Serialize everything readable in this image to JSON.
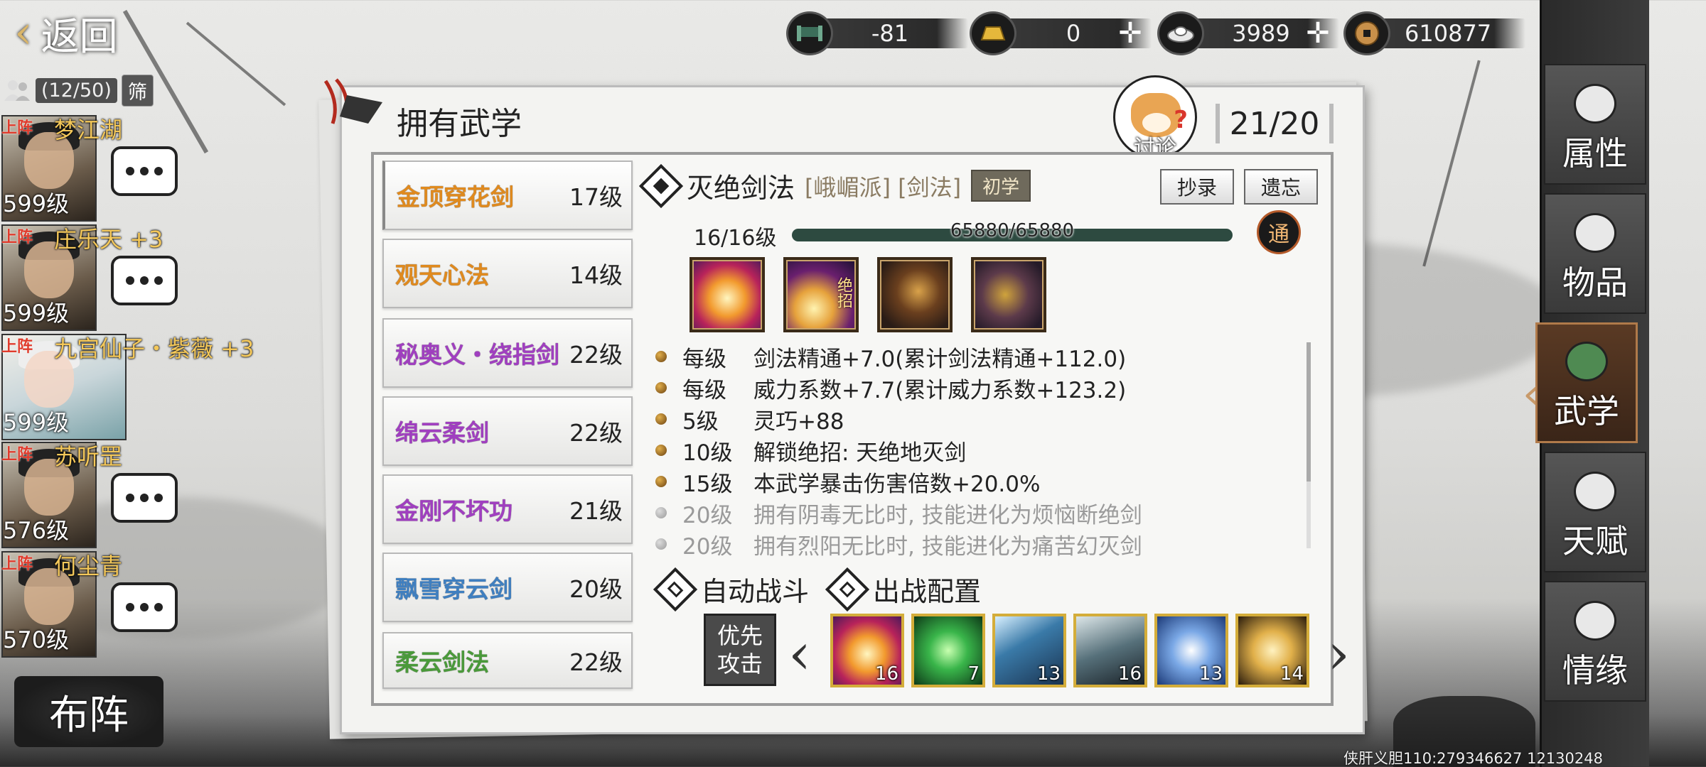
{
  "topbar": {
    "back_label": "返回",
    "resources": [
      {
        "icon": "bed-icon",
        "value": "-81",
        "has_plus": false
      },
      {
        "icon": "gold-ingot-icon",
        "value": "0",
        "has_plus": true
      },
      {
        "icon": "silver-ingot-icon",
        "value": "3989",
        "has_plus": true
      },
      {
        "icon": "copper-coin-icon",
        "value": "610877",
        "has_plus": false
      }
    ]
  },
  "roster": {
    "count": "(12/50)",
    "filter_label": "筛",
    "heroes": [
      {
        "deploy": "上阵",
        "name": "梦江湖",
        "level": "599级"
      },
      {
        "deploy": "上阵",
        "name": "庄乐天 +3",
        "level": "599级"
      },
      {
        "deploy": "上阵",
        "name": "九宫仙子・紫薇 +3",
        "level": "599级"
      },
      {
        "deploy": "上阵",
        "name": "苏听罡",
        "level": "576级"
      },
      {
        "deploy": "上阵",
        "name": "何尘青",
        "level": "570级"
      }
    ],
    "formation_label": "布阵"
  },
  "panel": {
    "title": "拥有武学",
    "discuss_label": "讨论",
    "count": "21/20",
    "skills": [
      {
        "name": "金顶穿花剑",
        "level": "17级",
        "color": "#e08a1e"
      },
      {
        "name": "观天心法",
        "level": "14级",
        "color": "#e08a1e"
      },
      {
        "name": "秘奥义・绕指剑",
        "level": "22级",
        "color": "#a03fc0"
      },
      {
        "name": "绵云柔剑",
        "level": "22级",
        "color": "#a03fc0"
      },
      {
        "name": "金刚不坏功",
        "level": "21级",
        "color": "#a03fc0"
      },
      {
        "name": "飘雪穿云剑",
        "level": "20级",
        "color": "#3f7fc0"
      },
      {
        "name": "柔云剑法",
        "level": "22级",
        "color": "#4a9a3a"
      }
    ]
  },
  "detail": {
    "name": "灭绝剑法",
    "tags": "[峨嵋派] [剑法]",
    "badge": "初学",
    "copy_label": "抄录",
    "forget_label": "遗忘",
    "level": "16/16级",
    "exp_text": "65880/65880",
    "exp_fraction": 1.0,
    "tong_label": "通",
    "ultimate_label": "绝招",
    "effects": [
      {
        "lv": "每级",
        "text": "剑法精通+7.0(累计剑法精通+112.0)",
        "active": true
      },
      {
        "lv": "每级",
        "text": "威力系数+7.7(累计威力系数+123.2)",
        "active": true
      },
      {
        "lv": "5级",
        "text": "灵巧+88",
        "active": true
      },
      {
        "lv": "10级",
        "text": "解锁绝招: 天绝地灭剑",
        "active": true
      },
      {
        "lv": "15级",
        "text": "本武学暴击伤害倍数+20.0%",
        "active": true
      },
      {
        "lv": "20级",
        "text": "拥有阴毒无比时, 技能进化为烦恼断绝剑",
        "active": false
      },
      {
        "lv": "20级",
        "text": "拥有烈阳无比时, 技能进化为痛苦幻灭剑",
        "active": false
      }
    ],
    "auto_battle_label": "自动战斗",
    "battle_config_label": "出战配置",
    "priority_label": [
      "优先",
      "攻击"
    ],
    "slots": [
      "16",
      "7",
      "13",
      "16",
      "13",
      "14"
    ]
  },
  "nav": {
    "tabs": [
      {
        "label": "属性",
        "active": false
      },
      {
        "label": "物品",
        "active": false
      },
      {
        "label": "武学",
        "active": true
      },
      {
        "label": "天赋",
        "active": false
      },
      {
        "label": "情缘",
        "active": false
      }
    ]
  },
  "footer_text": "侠肝义胆110:279346627 12130248"
}
